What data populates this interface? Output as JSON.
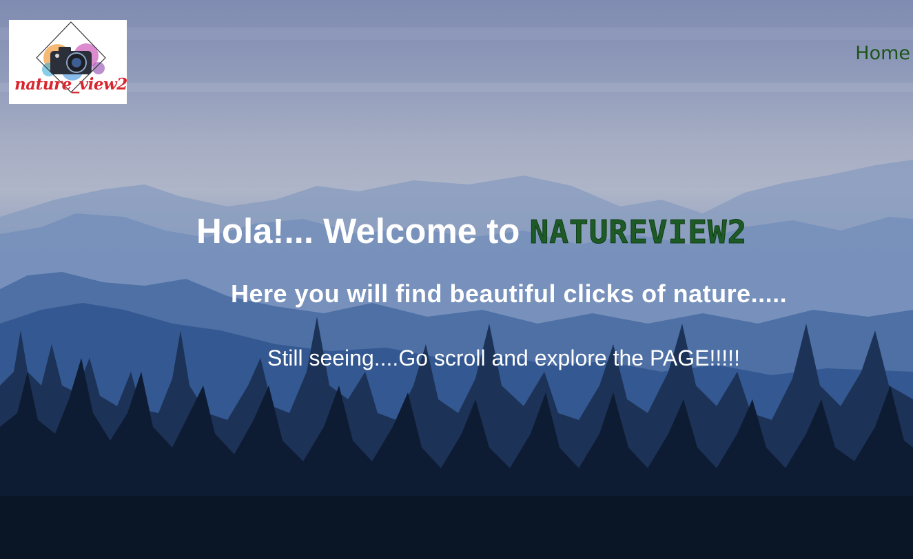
{
  "logo": {
    "text": "nature_view2",
    "icon": "camera-icon"
  },
  "nav": {
    "home_label": "Home"
  },
  "hero": {
    "headline_prefix": "Hola!... Welcome to ",
    "brand_name": "NATUREVIEW2",
    "subheading": "Here you will find beautiful clicks of nature.....",
    "tagline": "Still seeing....Go scroll and explore the PAGE!!!!!"
  },
  "colors": {
    "nav_link": "#1c5418",
    "brand_green": "#1d5a26",
    "logo_red": "#d8262e",
    "hero_text": "#ffffff"
  }
}
